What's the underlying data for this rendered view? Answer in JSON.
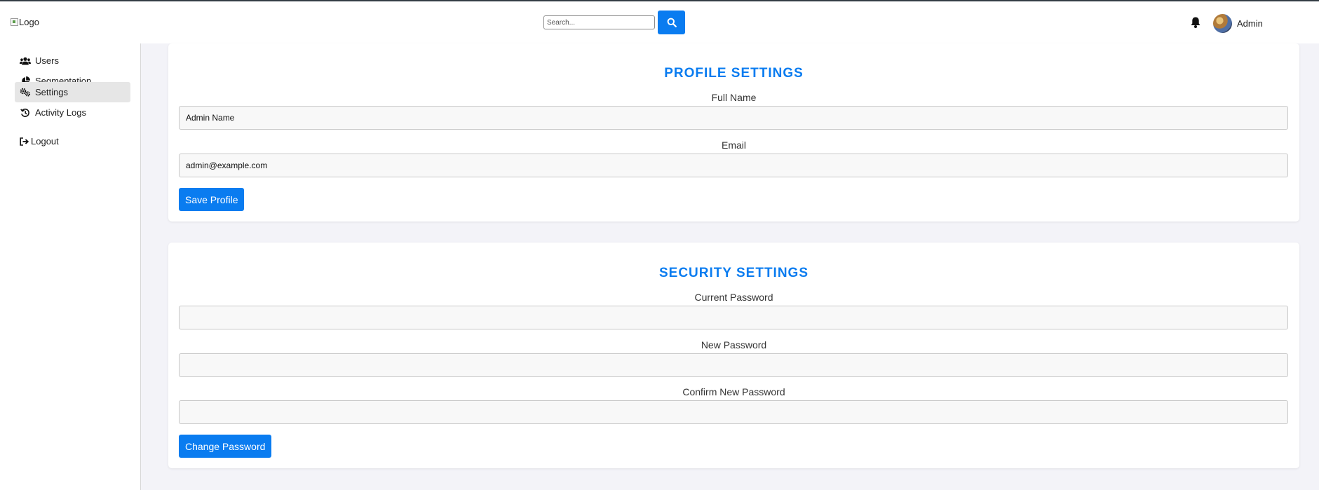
{
  "header": {
    "logo_alt": "Logo",
    "search": {
      "placeholder": "Search...",
      "value": ""
    },
    "user_name": "Admin"
  },
  "sidebar": {
    "items": [
      {
        "label": "Users",
        "icon": "users-icon",
        "active": false
      },
      {
        "label": "Segmentation",
        "icon": "pie-chart-icon",
        "active": false
      },
      {
        "label": "Settings",
        "icon": "cogs-icon",
        "active": true
      },
      {
        "label": "Activity Logs",
        "icon": "history-icon",
        "active": false
      },
      {
        "label": "Logout",
        "icon": "sign-out-icon",
        "active": false
      }
    ]
  },
  "profile": {
    "title": "PROFILE SETTINGS",
    "full_name_label": "Full Name",
    "full_name_value": "Admin Name",
    "email_label": "Email",
    "email_value": "admin@example.com",
    "save_label": "Save Profile"
  },
  "security": {
    "title": "SECURITY SETTINGS",
    "current_label": "Current Password",
    "current_value": "",
    "new_label": "New Password",
    "new_value": "",
    "confirm_label": "Confirm New Password",
    "confirm_value": "",
    "change_label": "Change Password"
  },
  "colors": {
    "accent": "#0a7cf0",
    "background": "#f3f3f8"
  }
}
